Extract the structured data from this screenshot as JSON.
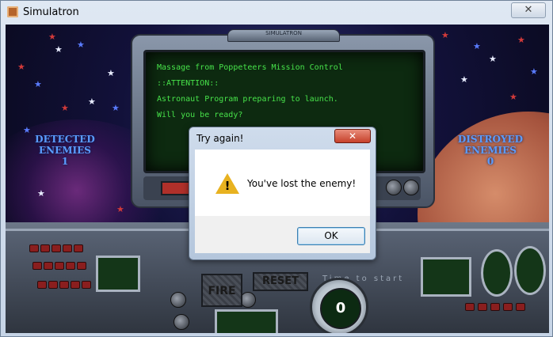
{
  "window": {
    "title": "Simulatron",
    "close_glyph": "✕"
  },
  "game": {
    "detected_label": "DETECTED ENEMIES",
    "detected_value": "1",
    "destroyed_label": "DISTROYED ENEMIES",
    "destroyed_value": "0",
    "monitor_brand": "SIMULATRON",
    "screen_lines": [
      "Massage from Poppeteers Mission Control",
      "::ATTENTION::",
      "Astronaut Program preparing to launch.",
      "Will you be ready?"
    ],
    "fire_label": "FIRE",
    "reset_label": "RESET",
    "time_label": "Time to start",
    "radar_value": "0"
  },
  "dialog": {
    "title": "Try again!",
    "close_glyph": "✕",
    "message": "You've lost the enemy!",
    "ok_label": "OK",
    "icon": "warning-icon"
  },
  "colors": {
    "stat_text": "#5a9cff",
    "screen_text": "#47e24a",
    "dialog_close": "#c7412b"
  }
}
